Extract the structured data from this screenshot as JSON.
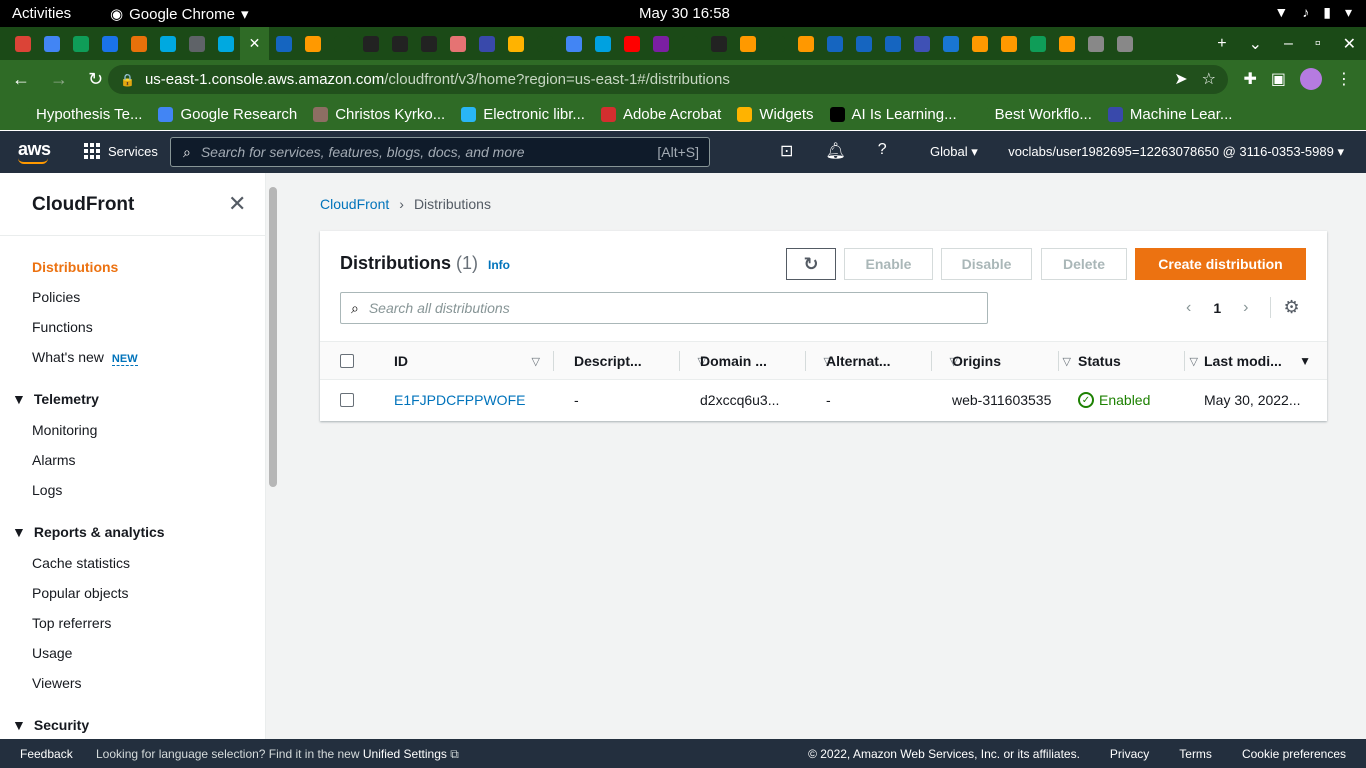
{
  "gnome": {
    "activities": "Activities",
    "app": "Google Chrome",
    "clock": "May 30  16:58"
  },
  "browser": {
    "url_host": "us-east-1.console.aws.amazon.com",
    "url_path": "/cloudfront/v3/home?region=us-east-1#/distributions",
    "tab_colors": [
      "#db4437",
      "#4285f4",
      "#0f9d58",
      "#1a73e8",
      "#e8710a",
      "#00a9e0",
      "#5f6368",
      "#00a9e0",
      "#2f6b26",
      "#1565c0",
      "#ff9900",
      "#1b4a17",
      "#222",
      "#222",
      "#222",
      "#e57373",
      "#3949ab",
      "#ffb300",
      "#1b4a17",
      "#4285f4",
      "#00a1e0",
      "#ff0000",
      "#7b1fa2",
      "#1b4a17",
      "#222",
      "#ff9900",
      "#1b4a17",
      "#ff9800",
      "#1565c0",
      "#1565c0",
      "#1565c0",
      "#3f51b5",
      "#1976d2",
      "#ff9900",
      "#ff9900",
      "#0f9d58",
      "#ff9900",
      "#888",
      "#888"
    ]
  },
  "bookmarks": [
    {
      "label": "Hypothesis Te...",
      "color": "#2f6b26"
    },
    {
      "label": "Google Research",
      "color": "#4285f4"
    },
    {
      "label": "Christos Kyrko...",
      "color": "#8d6e63"
    },
    {
      "label": "Electronic libr...",
      "color": "#29b6f6"
    },
    {
      "label": "Adobe Acrobat",
      "color": "#d32f2f"
    },
    {
      "label": "Widgets",
      "color": "#ffb300"
    },
    {
      "label": "AI Is Learning...",
      "color": "#000000"
    },
    {
      "label": "Best Workflo...",
      "color": "#2f6b26"
    },
    {
      "label": "Machine Lear...",
      "color": "#3949ab"
    }
  ],
  "aws": {
    "services": "Services",
    "search_placeholder": "Search for services, features, blogs, docs, and more",
    "search_shortcut": "[Alt+S]",
    "region": "Global",
    "account": "voclabs/user1982695=12263078650 @ 3116-0353-5989"
  },
  "sidebar": {
    "title": "CloudFront",
    "items": [
      {
        "label": "Distributions"
      },
      {
        "label": "Policies"
      },
      {
        "label": "Functions"
      },
      {
        "label": "What's new",
        "badge": "NEW"
      }
    ],
    "sections": [
      {
        "label": "Telemetry",
        "items": [
          "Monitoring",
          "Alarms",
          "Logs"
        ]
      },
      {
        "label": "Reports & analytics",
        "items": [
          "Cache statistics",
          "Popular objects",
          "Top referrers",
          "Usage",
          "Viewers"
        ]
      },
      {
        "label": "Security"
      }
    ]
  },
  "breadcrumb": {
    "root": "CloudFront",
    "current": "Distributions"
  },
  "panel": {
    "title": "Distributions",
    "count": "(1)",
    "info": "Info",
    "enable": "Enable",
    "disable": "Disable",
    "delete": "Delete",
    "create": "Create distribution",
    "search_placeholder": "Search all distributions",
    "page": "1"
  },
  "table": {
    "columns": [
      "ID",
      "Descript...",
      "Domain ...",
      "Alternat...",
      "Origins",
      "Status",
      "Last modi..."
    ],
    "rows": [
      {
        "id": "E1FJPDCFPPWOFE",
        "description": "-",
        "domain": "d2xccq6u3...",
        "alternate": "-",
        "origins": "web-311603535",
        "status": "Enabled",
        "last_modified": "May 30, 2022..."
      }
    ]
  },
  "footer": {
    "feedback": "Feedback",
    "lang_text": "Looking for language selection? Find it in the new",
    "lang_link": "Unified Settings",
    "copyright": "© 2022, Amazon Web Services, Inc. or its affiliates.",
    "privacy": "Privacy",
    "terms": "Terms",
    "cookie": "Cookie preferences"
  }
}
